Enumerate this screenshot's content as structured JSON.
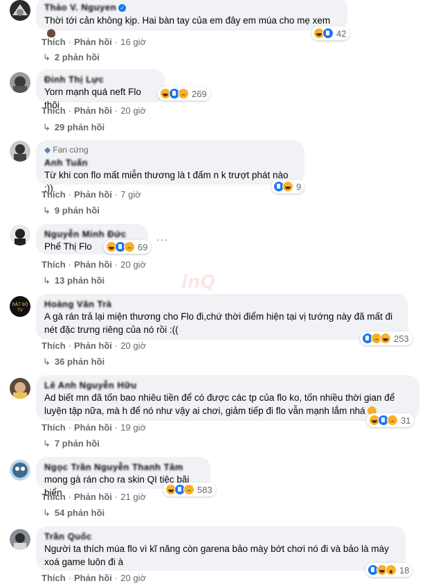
{
  "labels": {
    "like": "Thích",
    "reply": "Phản hồi",
    "dot": "·"
  },
  "colors": {
    "bubble": "#f0f2f5",
    "meta": "#65676b",
    "verified": "#1877f2"
  },
  "comments": [
    {
      "name": "Thảo V. Nguyen",
      "verified": true,
      "text": "Thời tới cản không kịp. Hai bàn tay của em đây em múa cho mẹ xem",
      "time": "16 giờ",
      "reaction_count": "42",
      "reactions": [
        "haha",
        "like"
      ],
      "replies": "2 phản hồi"
    },
    {
      "name": "Đinh Thị Lực",
      "text": "Yorn mạnh quá neft Flo thôi",
      "time": "20 giờ",
      "reaction_count": "269",
      "reactions": [
        "haha",
        "like",
        "sad"
      ],
      "replies": "29 phản hồi"
    },
    {
      "badge": "Fan cứng",
      "name": "Anh Tuấn",
      "text": "Từ khi con flo mất miễn thương là t đấm n k trượt phát nào :))",
      "time": "7 giờ",
      "reaction_count": "9",
      "reactions": [
        "like",
        "haha"
      ],
      "replies": "9 phản hồi"
    },
    {
      "name": "Nguyễn Minh Đức",
      "text": "Phế Thị Flo",
      "time": "20 giờ",
      "reaction_count": "69",
      "reactions": [
        "haha",
        "like",
        "sad"
      ],
      "replies": "13 phản hồi"
    },
    {
      "name": "Hoàng Văn Trà",
      "text": "A gà rán trả lại miện thương cho Flo đi,chứ thời điểm hiện tại vị tướng này đã mất đi nét đặc trưng riêng của nó rồi :((",
      "time": "20 giờ",
      "reaction_count": "253",
      "reactions": [
        "like",
        "sad",
        "haha"
      ],
      "replies": "36 phản hồi"
    },
    {
      "name": "Lê Anh Nguyễn Hữu",
      "text": "Ad biết mn đã tốn bao nhiêu tiền để có được các tp của flo ko, tốn nhiều thời gian để luyện tập nữa, mà h để nó như vậy ai chơi, giảm tiếp đi flo vẫn mạnh lắm nhá",
      "time": "19 giờ",
      "reaction_count": "31",
      "reactions": [
        "haha",
        "like",
        "sad"
      ],
      "replies": "7 phản hồi"
    },
    {
      "name": "Ngọc Trần Nguyễn Thanh Tâm",
      "text": "mong gà rán cho ra skin QI tiệc bãi biển",
      "time": "21 giờ",
      "reaction_count": "583",
      "reactions": [
        "haha",
        "like",
        "sad"
      ],
      "replies": "54 phản hồi"
    },
    {
      "name": "Trần Quốc",
      "text": "Người ta thích múa flo vì kĩ năng còn garena bảo mày bớt chơi nó đi và bảo là mày xoá game luôn đi à",
      "time": "20 giờ",
      "reaction_count": "18",
      "reactions": [
        "like",
        "haha",
        "wow"
      ],
      "replies": ""
    }
  ]
}
